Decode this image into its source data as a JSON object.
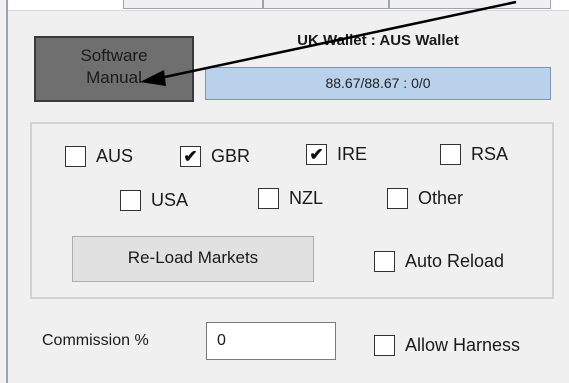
{
  "manual_button": {
    "line1": "Software",
    "line2": "Manual"
  },
  "wallet": {
    "title": "UK Wallet : AUS Wallet",
    "value": "88.67/88.67  :  0/0"
  },
  "markets": {
    "checkboxes": [
      {
        "label": "AUS",
        "checked": false,
        "mark": ""
      },
      {
        "label": "GBR",
        "checked": true,
        "mark": "✔"
      },
      {
        "label": "IRE",
        "checked": true,
        "mark": "✔"
      },
      {
        "label": "RSA",
        "checked": false,
        "mark": ""
      },
      {
        "label": "USA",
        "checked": false,
        "mark": ""
      },
      {
        "label": "NZL",
        "checked": false,
        "mark": ""
      },
      {
        "label": "Other",
        "checked": false,
        "mark": ""
      }
    ],
    "reload_label": "Re-Load Markets",
    "auto_reload": {
      "label": "Auto Reload",
      "checked": false,
      "mark": ""
    }
  },
  "commission": {
    "label": "Commission %",
    "value": "0"
  },
  "allow_harness": {
    "label": "Allow Harness",
    "checked": false,
    "mark": ""
  },
  "colors": {
    "panel": "#f0f0f0",
    "wallet_bar": "#b9d1ea",
    "manual_button": "#6f6f6f",
    "arrow": "#000000"
  }
}
